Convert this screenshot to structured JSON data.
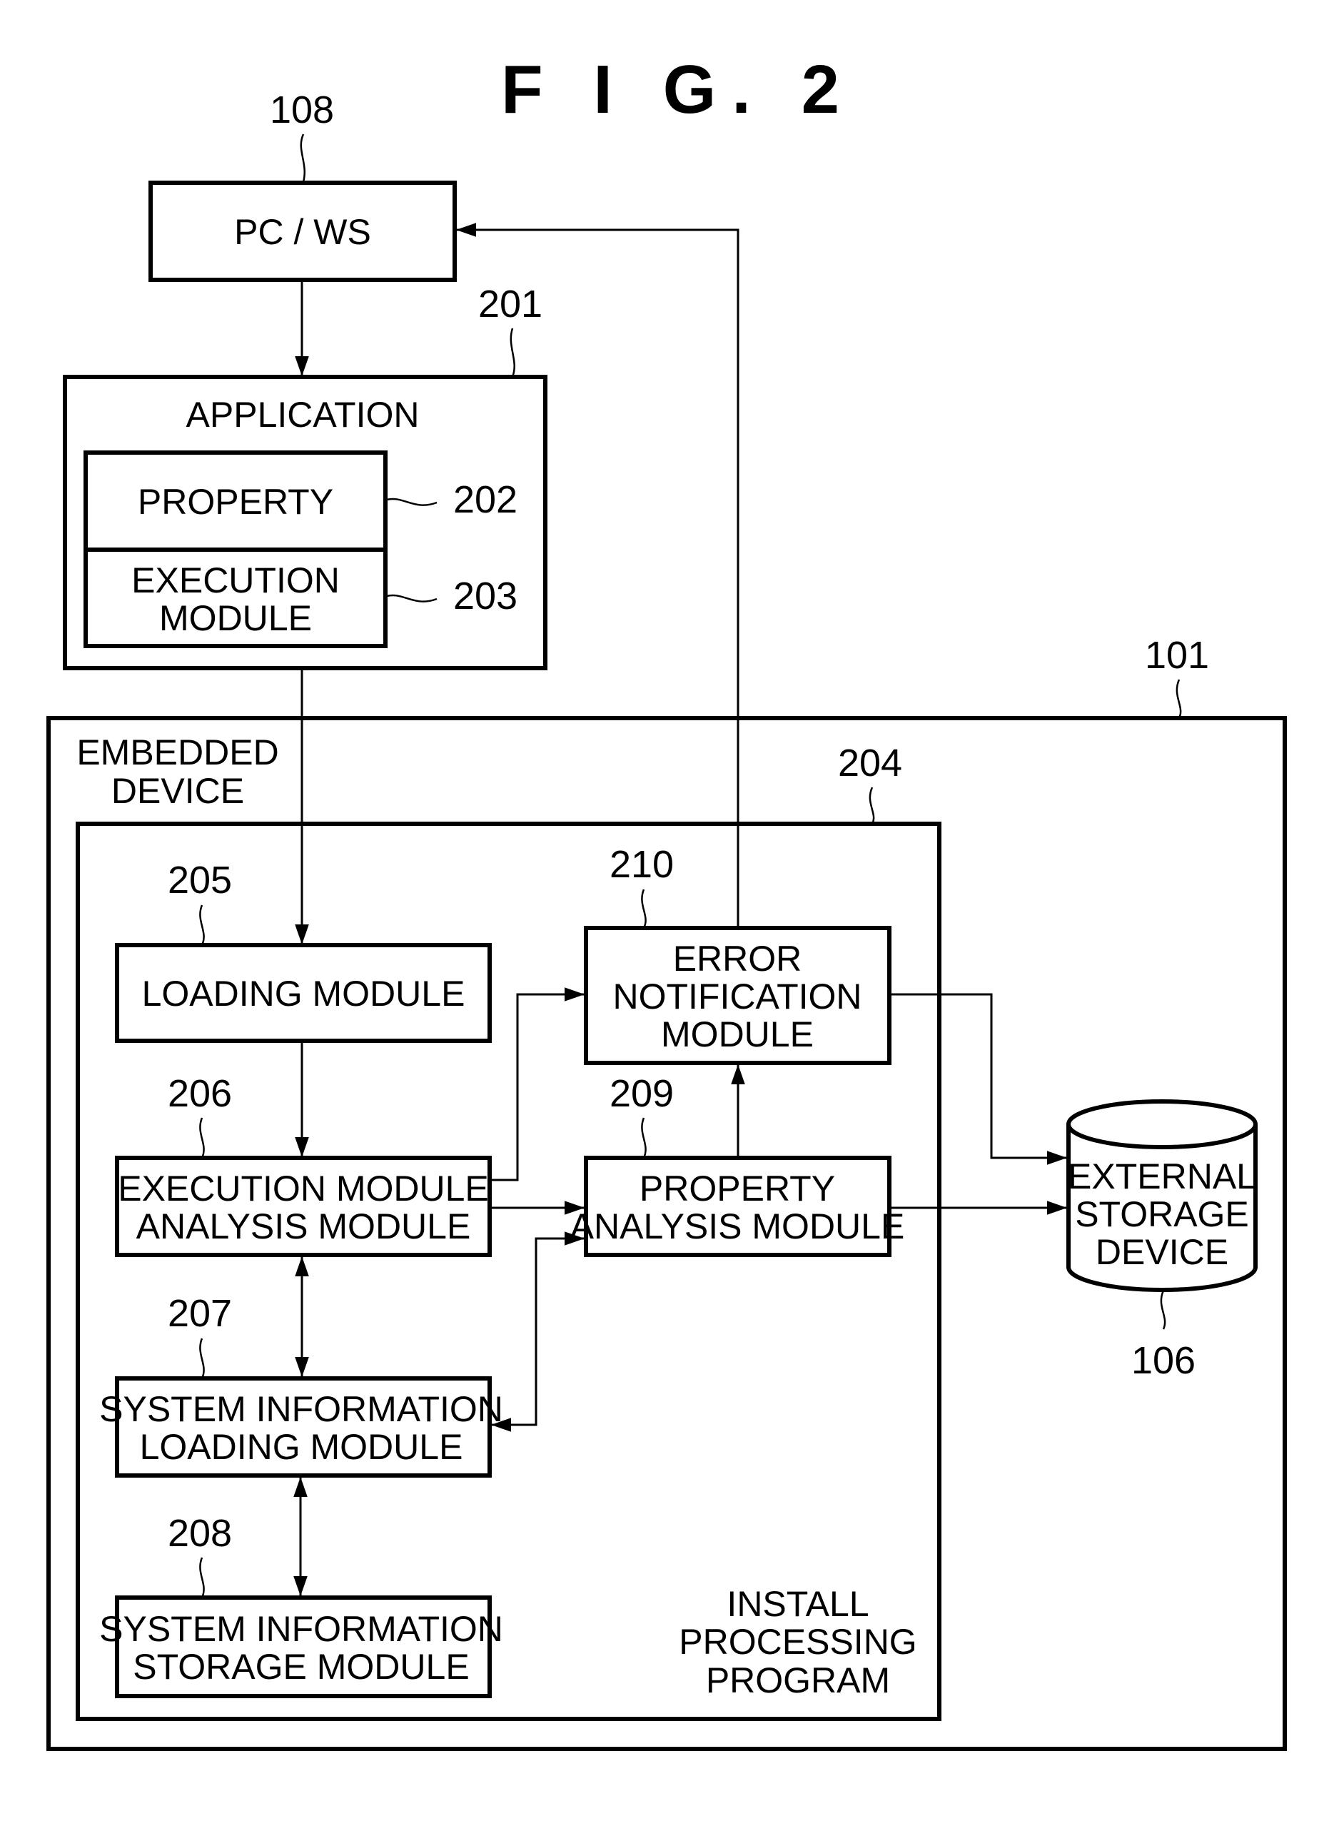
{
  "figure": {
    "title": "F I G.  2",
    "nodes": {
      "pc_ws": {
        "ref": "108",
        "label": "PC / WS"
      },
      "application": {
        "ref": "201",
        "label": "APPLICATION"
      },
      "property": {
        "ref": "202",
        "label": "PROPERTY"
      },
      "execution_module": {
        "ref": "203",
        "lines": [
          "EXECUTION",
          "MODULE"
        ]
      },
      "embedded_device": {
        "ref": "101",
        "lines": [
          "EMBEDDED",
          "DEVICE"
        ]
      },
      "install_program": {
        "ref": "204",
        "lines": [
          "INSTALL",
          "PROCESSING",
          "PROGRAM"
        ]
      },
      "loading_module": {
        "ref": "205",
        "label": "LOADING MODULE"
      },
      "exec_analysis": {
        "ref": "206",
        "lines": [
          "EXECUTION MODULE",
          "ANALYSIS MODULE"
        ]
      },
      "sysinfo_loading": {
        "ref": "207",
        "lines": [
          "SYSTEM INFORMATION",
          "LOADING MODULE"
        ]
      },
      "sysinfo_storage": {
        "ref": "208",
        "lines": [
          "SYSTEM INFORMATION",
          "STORAGE MODULE"
        ]
      },
      "property_analysis": {
        "ref": "209",
        "lines": [
          "PROPERTY",
          "ANALYSIS MODULE"
        ]
      },
      "error_notification": {
        "ref": "210",
        "lines": [
          "ERROR",
          "NOTIFICATION",
          "MODULE"
        ]
      },
      "external_storage": {
        "ref": "106",
        "lines": [
          "EXTERNAL",
          "STORAGE",
          "DEVICE"
        ]
      }
    },
    "edges": [
      {
        "from": "PC / WS",
        "to": "APPLICATION"
      },
      {
        "from": "APPLICATION",
        "to": "LOADING MODULE"
      },
      {
        "from": "LOADING MODULE",
        "to": "EXECUTION MODULE ANALYSIS MODULE"
      },
      {
        "from": "EXECUTION MODULE ANALYSIS MODULE",
        "to": "SYSTEM INFORMATION LOADING MODULE",
        "bidirectional": true
      },
      {
        "from": "SYSTEM INFORMATION LOADING MODULE",
        "to": "SYSTEM INFORMATION STORAGE MODULE",
        "bidirectional": true
      },
      {
        "from": "EXECUTION MODULE ANALYSIS MODULE",
        "to": "ERROR NOTIFICATION MODULE"
      },
      {
        "from": "EXECUTION MODULE ANALYSIS MODULE",
        "to": "PROPERTY ANALYSIS MODULE"
      },
      {
        "from": "PROPERTY ANALYSIS MODULE",
        "to": "SYSTEM INFORMATION LOADING MODULE",
        "bidirectional": true
      },
      {
        "from": "PROPERTY ANALYSIS MODULE",
        "to": "ERROR NOTIFICATION MODULE"
      },
      {
        "from": "ERROR NOTIFICATION MODULE",
        "to": "PC / WS"
      },
      {
        "from": "ERROR NOTIFICATION MODULE",
        "to": "EXTERNAL STORAGE DEVICE"
      },
      {
        "from": "PROPERTY ANALYSIS MODULE",
        "to": "EXTERNAL STORAGE DEVICE"
      }
    ]
  }
}
